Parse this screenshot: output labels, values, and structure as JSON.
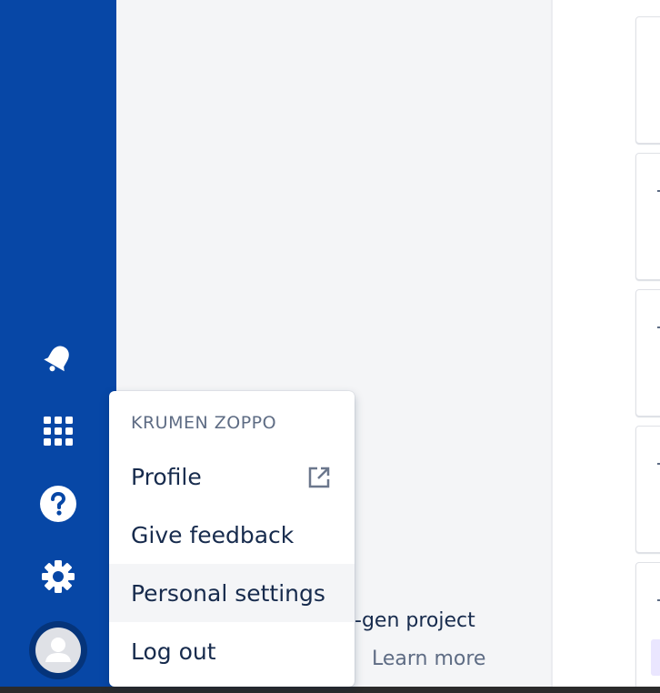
{
  "sidebar": {
    "icons": [
      "notifications-icon",
      "app-switcher-icon",
      "help-icon",
      "settings-icon",
      "profile-avatar-icon"
    ]
  },
  "panel": {
    "teaser_text": "-gen project",
    "learn_more": "Learn more"
  },
  "profile_menu": {
    "heading": "KRUMEN ZOPPO",
    "items": [
      {
        "label": "Profile",
        "icon": "external-link-icon"
      },
      {
        "label": "Give feedback"
      },
      {
        "label": "Personal settings"
      },
      {
        "label": "Log out"
      }
    ]
  },
  "colors": {
    "sidebar": "#0747a6",
    "panel": "#f4f5f7",
    "text": "#172b4d",
    "muted": "#5e6c84"
  }
}
